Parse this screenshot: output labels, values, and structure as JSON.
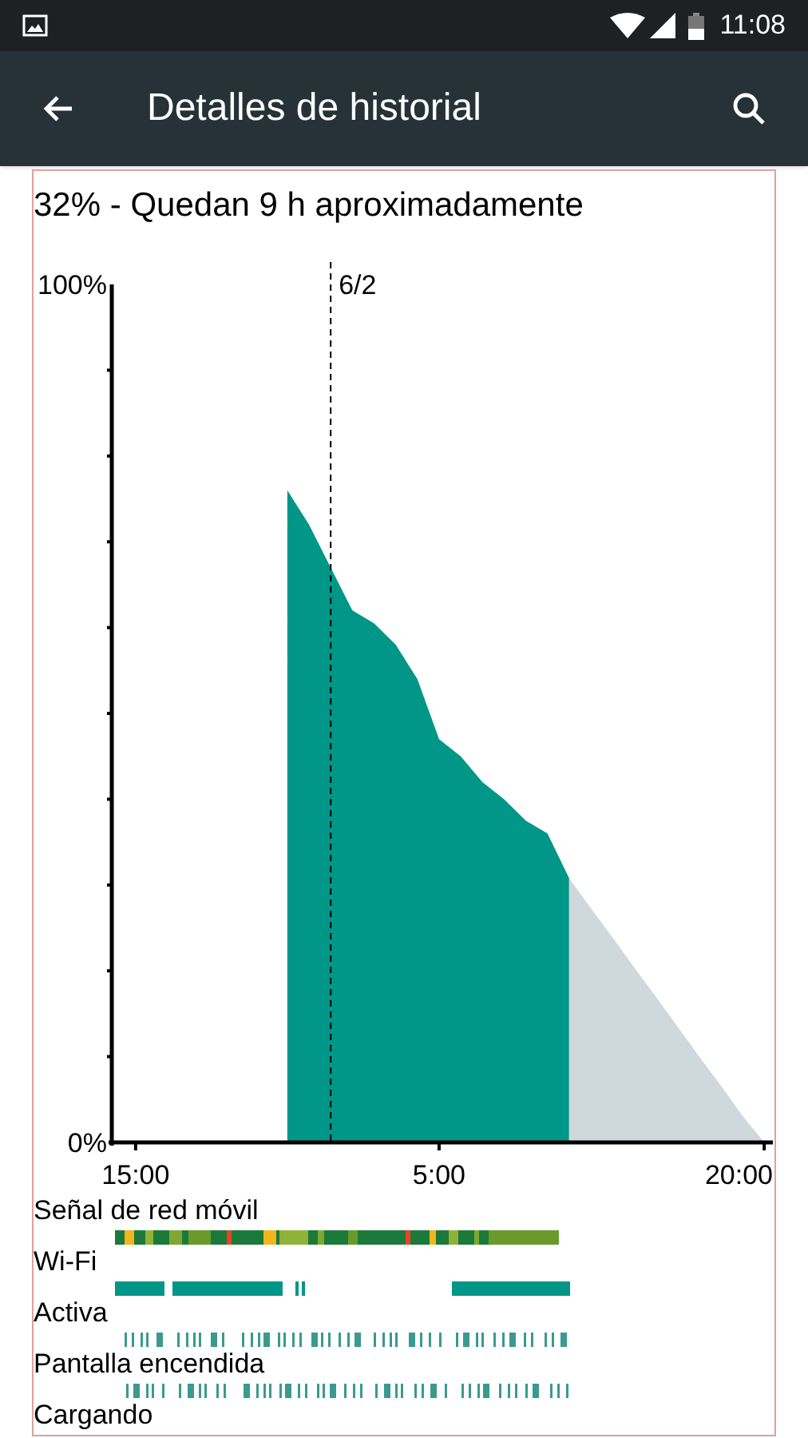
{
  "status_bar": {
    "time": "11:08"
  },
  "app_bar": {
    "title": "Detalles de historial"
  },
  "summary": "32% - Quedan 9 h aproximadamente",
  "chart_data": {
    "type": "area",
    "categories": [
      null,
      "15:00",
      null,
      null,
      null,
      null,
      null,
      null,
      null,
      null,
      null,
      null,
      null,
      null,
      null,
      "5:00",
      null,
      null,
      null,
      null,
      null,
      null,
      null,
      null,
      null,
      null,
      null,
      null,
      null,
      null,
      "20:00"
    ],
    "series": [
      {
        "color": "#009688",
        "values": [
          null,
          null,
          null,
          null,
          null,
          null,
          null,
          null,
          76,
          72,
          67,
          62,
          60.5,
          58,
          54,
          47,
          45,
          42,
          40,
          37.5,
          36,
          30.8,
          null,
          null,
          null,
          null,
          null,
          null,
          null,
          null,
          null
        ]
      },
      {
        "color": "#cfd8dc",
        "values": [
          null,
          null,
          null,
          null,
          null,
          null,
          null,
          null,
          null,
          null,
          null,
          null,
          null,
          null,
          null,
          null,
          null,
          null,
          null,
          null,
          null,
          30.8,
          27.3,
          23.9,
          20.4,
          17,
          13.5,
          10,
          6.6,
          3.1,
          0
        ]
      }
    ],
    "ylim": [
      0,
      100
    ],
    "yticks": [
      {
        "value": 0,
        "label": "0%"
      },
      {
        "value": 100,
        "label": "100%"
      }
    ],
    "annotations": [
      "6/2"
    ]
  },
  "tracks": [
    {
      "label": "Señal de red móvil",
      "kind": "signal"
    },
    {
      "label": "Wi-Fi",
      "kind": "wifi"
    },
    {
      "label": "Activa",
      "kind": "ticks"
    },
    {
      "label": "Pantalla encendida",
      "kind": "ticks"
    },
    {
      "label": "Cargando",
      "kind": "none"
    }
  ]
}
